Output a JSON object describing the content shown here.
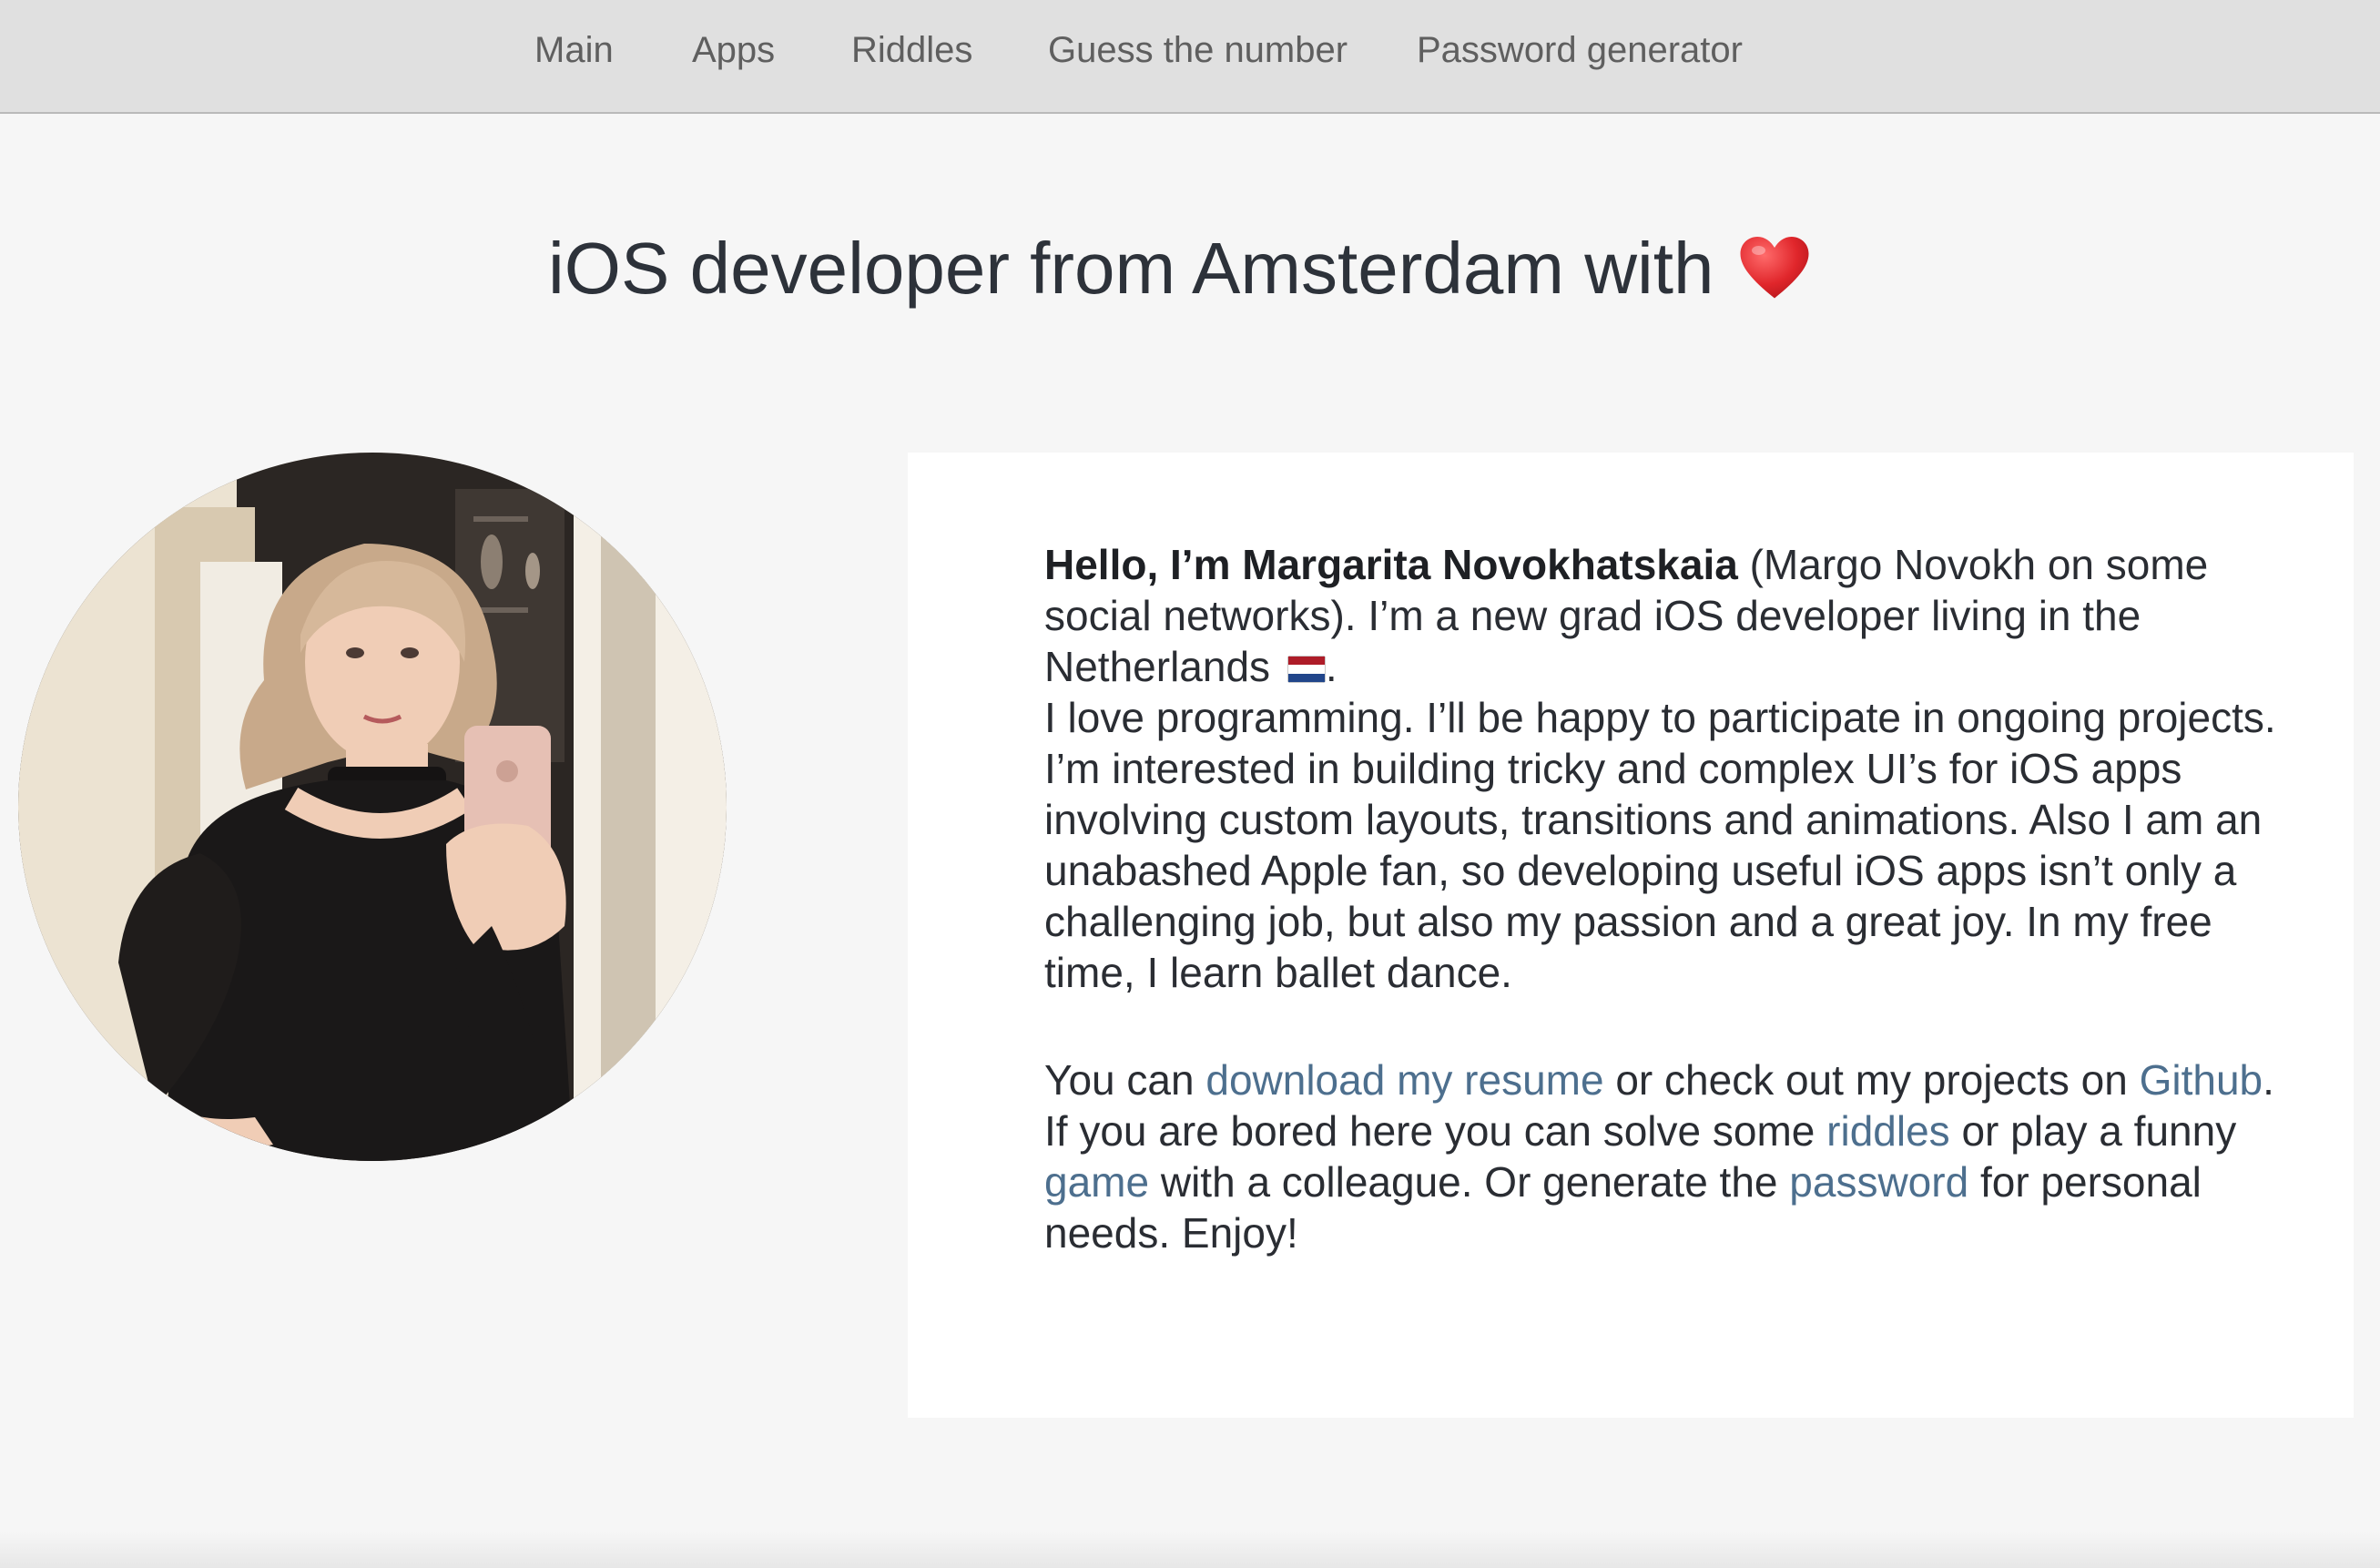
{
  "nav": {
    "items": [
      {
        "label": "Main"
      },
      {
        "label": "Apps"
      },
      {
        "label": "Riddles"
      },
      {
        "label": "Guess the number"
      },
      {
        "label": "Password generator"
      }
    ]
  },
  "header": {
    "title": "iOS developer from Amsterdam with",
    "title_icon": "heart-icon"
  },
  "profile": {
    "photo": "selfie-photo"
  },
  "about": {
    "greeting_bold": "Hello, I’m Margarita Novokhatskaia",
    "greeting_rest": " (Margo Novokh on some social networks). I’m a new grad iOS developer living in the Netherlands ",
    "flag_icon": "netherlands-flag-icon",
    "greeting_end": ".",
    "paragraph2": "I love programming. I’ll be happy to participate in ongoing projects. I’m interested in building tricky and complex UI’s for iOS apps involving custom layouts, transitions and animations. Also I am an unabashed Apple fan, so developing useful iOS apps isn’t only a challenging job, but also my passion and a great joy. In my free time, I learn ballet dance.",
    "p3_prefix": "You can ",
    "resume_link": "download my resume",
    "p3_mid1": " or check out my projects on ",
    "github_link": "Github",
    "p3_mid2": ". If you are bored here you can solve some ",
    "riddles_link": "riddles",
    "p3_mid3": " or play a funny ",
    "game_link": "game",
    "p3_mid4": " with a colleague. Or generate the ",
    "password_link": "password",
    "p3_suffix": " for personal needs. Enjoy!"
  },
  "colors": {
    "navbar_bg": "#e0e0e0",
    "page_bg": "#f6f6f6",
    "card_bg": "#ffffff",
    "link": "#4d6f8e",
    "heart": "#e0262b"
  }
}
